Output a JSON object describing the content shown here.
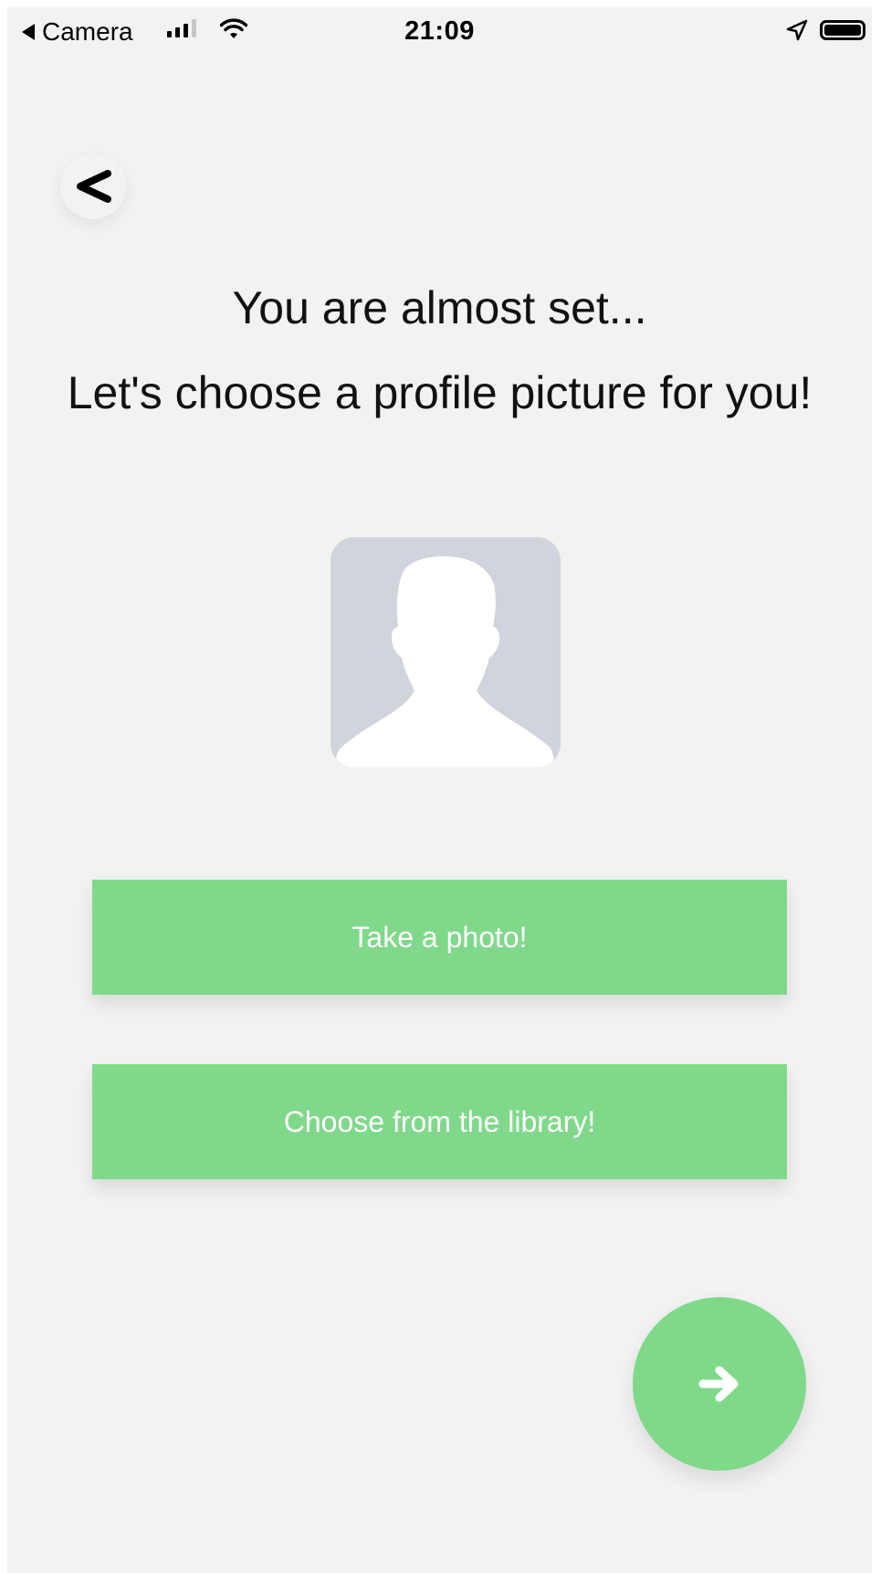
{
  "status_bar": {
    "back_app_label": "Camera",
    "time": "21:09",
    "icons": [
      "back-triangle-icon",
      "signal-bars-icon",
      "wifi-icon",
      "location-arrow-icon",
      "battery-icon"
    ]
  },
  "header": {
    "back_icon": "chevron-left-icon"
  },
  "main": {
    "title_line1": "You are almost set...",
    "title_line2": "Let's choose a profile picture for you!",
    "avatar_icon": "person-silhouette-icon"
  },
  "actions": {
    "take_photo_label": "Take a photo!",
    "choose_library_label": "Choose from the library!"
  },
  "fab": {
    "icon": "arrow-right-icon"
  },
  "colors": {
    "background": "#f2f2f2",
    "accent_green": "#80d98b",
    "avatar_bg": "#d1d5db",
    "text": "#111111"
  }
}
